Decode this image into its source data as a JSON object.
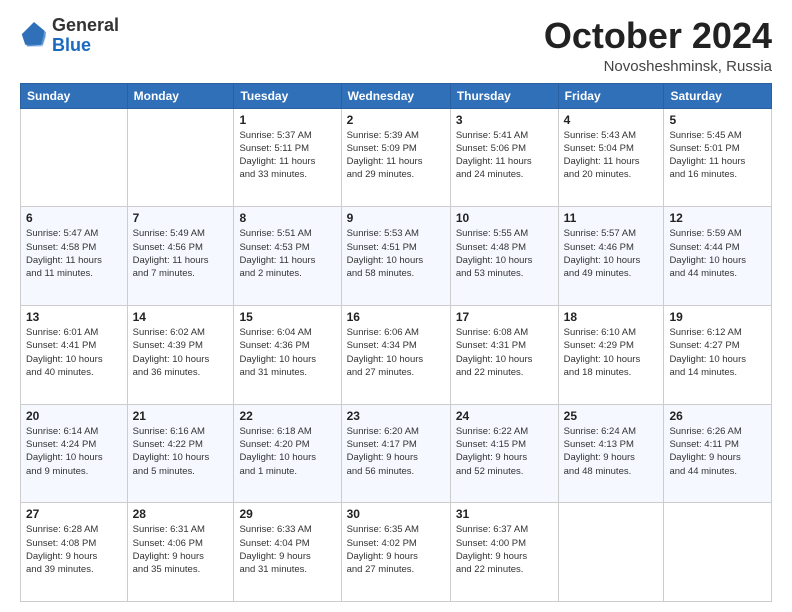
{
  "header": {
    "logo_general": "General",
    "logo_blue": "Blue",
    "month_title": "October 2024",
    "subtitle": "Novosheshminsk, Russia"
  },
  "days_of_week": [
    "Sunday",
    "Monday",
    "Tuesday",
    "Wednesday",
    "Thursday",
    "Friday",
    "Saturday"
  ],
  "weeks": [
    [
      {
        "day": "",
        "info": ""
      },
      {
        "day": "",
        "info": ""
      },
      {
        "day": "1",
        "info": "Sunrise: 5:37 AM\nSunset: 5:11 PM\nDaylight: 11 hours\nand 33 minutes."
      },
      {
        "day": "2",
        "info": "Sunrise: 5:39 AM\nSunset: 5:09 PM\nDaylight: 11 hours\nand 29 minutes."
      },
      {
        "day": "3",
        "info": "Sunrise: 5:41 AM\nSunset: 5:06 PM\nDaylight: 11 hours\nand 24 minutes."
      },
      {
        "day": "4",
        "info": "Sunrise: 5:43 AM\nSunset: 5:04 PM\nDaylight: 11 hours\nand 20 minutes."
      },
      {
        "day": "5",
        "info": "Sunrise: 5:45 AM\nSunset: 5:01 PM\nDaylight: 11 hours\nand 16 minutes."
      }
    ],
    [
      {
        "day": "6",
        "info": "Sunrise: 5:47 AM\nSunset: 4:58 PM\nDaylight: 11 hours\nand 11 minutes."
      },
      {
        "day": "7",
        "info": "Sunrise: 5:49 AM\nSunset: 4:56 PM\nDaylight: 11 hours\nand 7 minutes."
      },
      {
        "day": "8",
        "info": "Sunrise: 5:51 AM\nSunset: 4:53 PM\nDaylight: 11 hours\nand 2 minutes."
      },
      {
        "day": "9",
        "info": "Sunrise: 5:53 AM\nSunset: 4:51 PM\nDaylight: 10 hours\nand 58 minutes."
      },
      {
        "day": "10",
        "info": "Sunrise: 5:55 AM\nSunset: 4:48 PM\nDaylight: 10 hours\nand 53 minutes."
      },
      {
        "day": "11",
        "info": "Sunrise: 5:57 AM\nSunset: 4:46 PM\nDaylight: 10 hours\nand 49 minutes."
      },
      {
        "day": "12",
        "info": "Sunrise: 5:59 AM\nSunset: 4:44 PM\nDaylight: 10 hours\nand 44 minutes."
      }
    ],
    [
      {
        "day": "13",
        "info": "Sunrise: 6:01 AM\nSunset: 4:41 PM\nDaylight: 10 hours\nand 40 minutes."
      },
      {
        "day": "14",
        "info": "Sunrise: 6:02 AM\nSunset: 4:39 PM\nDaylight: 10 hours\nand 36 minutes."
      },
      {
        "day": "15",
        "info": "Sunrise: 6:04 AM\nSunset: 4:36 PM\nDaylight: 10 hours\nand 31 minutes."
      },
      {
        "day": "16",
        "info": "Sunrise: 6:06 AM\nSunset: 4:34 PM\nDaylight: 10 hours\nand 27 minutes."
      },
      {
        "day": "17",
        "info": "Sunrise: 6:08 AM\nSunset: 4:31 PM\nDaylight: 10 hours\nand 22 minutes."
      },
      {
        "day": "18",
        "info": "Sunrise: 6:10 AM\nSunset: 4:29 PM\nDaylight: 10 hours\nand 18 minutes."
      },
      {
        "day": "19",
        "info": "Sunrise: 6:12 AM\nSunset: 4:27 PM\nDaylight: 10 hours\nand 14 minutes."
      }
    ],
    [
      {
        "day": "20",
        "info": "Sunrise: 6:14 AM\nSunset: 4:24 PM\nDaylight: 10 hours\nand 9 minutes."
      },
      {
        "day": "21",
        "info": "Sunrise: 6:16 AM\nSunset: 4:22 PM\nDaylight: 10 hours\nand 5 minutes."
      },
      {
        "day": "22",
        "info": "Sunrise: 6:18 AM\nSunset: 4:20 PM\nDaylight: 10 hours\nand 1 minute."
      },
      {
        "day": "23",
        "info": "Sunrise: 6:20 AM\nSunset: 4:17 PM\nDaylight: 9 hours\nand 56 minutes."
      },
      {
        "day": "24",
        "info": "Sunrise: 6:22 AM\nSunset: 4:15 PM\nDaylight: 9 hours\nand 52 minutes."
      },
      {
        "day": "25",
        "info": "Sunrise: 6:24 AM\nSunset: 4:13 PM\nDaylight: 9 hours\nand 48 minutes."
      },
      {
        "day": "26",
        "info": "Sunrise: 6:26 AM\nSunset: 4:11 PM\nDaylight: 9 hours\nand 44 minutes."
      }
    ],
    [
      {
        "day": "27",
        "info": "Sunrise: 6:28 AM\nSunset: 4:08 PM\nDaylight: 9 hours\nand 39 minutes."
      },
      {
        "day": "28",
        "info": "Sunrise: 6:31 AM\nSunset: 4:06 PM\nDaylight: 9 hours\nand 35 minutes."
      },
      {
        "day": "29",
        "info": "Sunrise: 6:33 AM\nSunset: 4:04 PM\nDaylight: 9 hours\nand 31 minutes."
      },
      {
        "day": "30",
        "info": "Sunrise: 6:35 AM\nSunset: 4:02 PM\nDaylight: 9 hours\nand 27 minutes."
      },
      {
        "day": "31",
        "info": "Sunrise: 6:37 AM\nSunset: 4:00 PM\nDaylight: 9 hours\nand 22 minutes."
      },
      {
        "day": "",
        "info": ""
      },
      {
        "day": "",
        "info": ""
      }
    ]
  ]
}
